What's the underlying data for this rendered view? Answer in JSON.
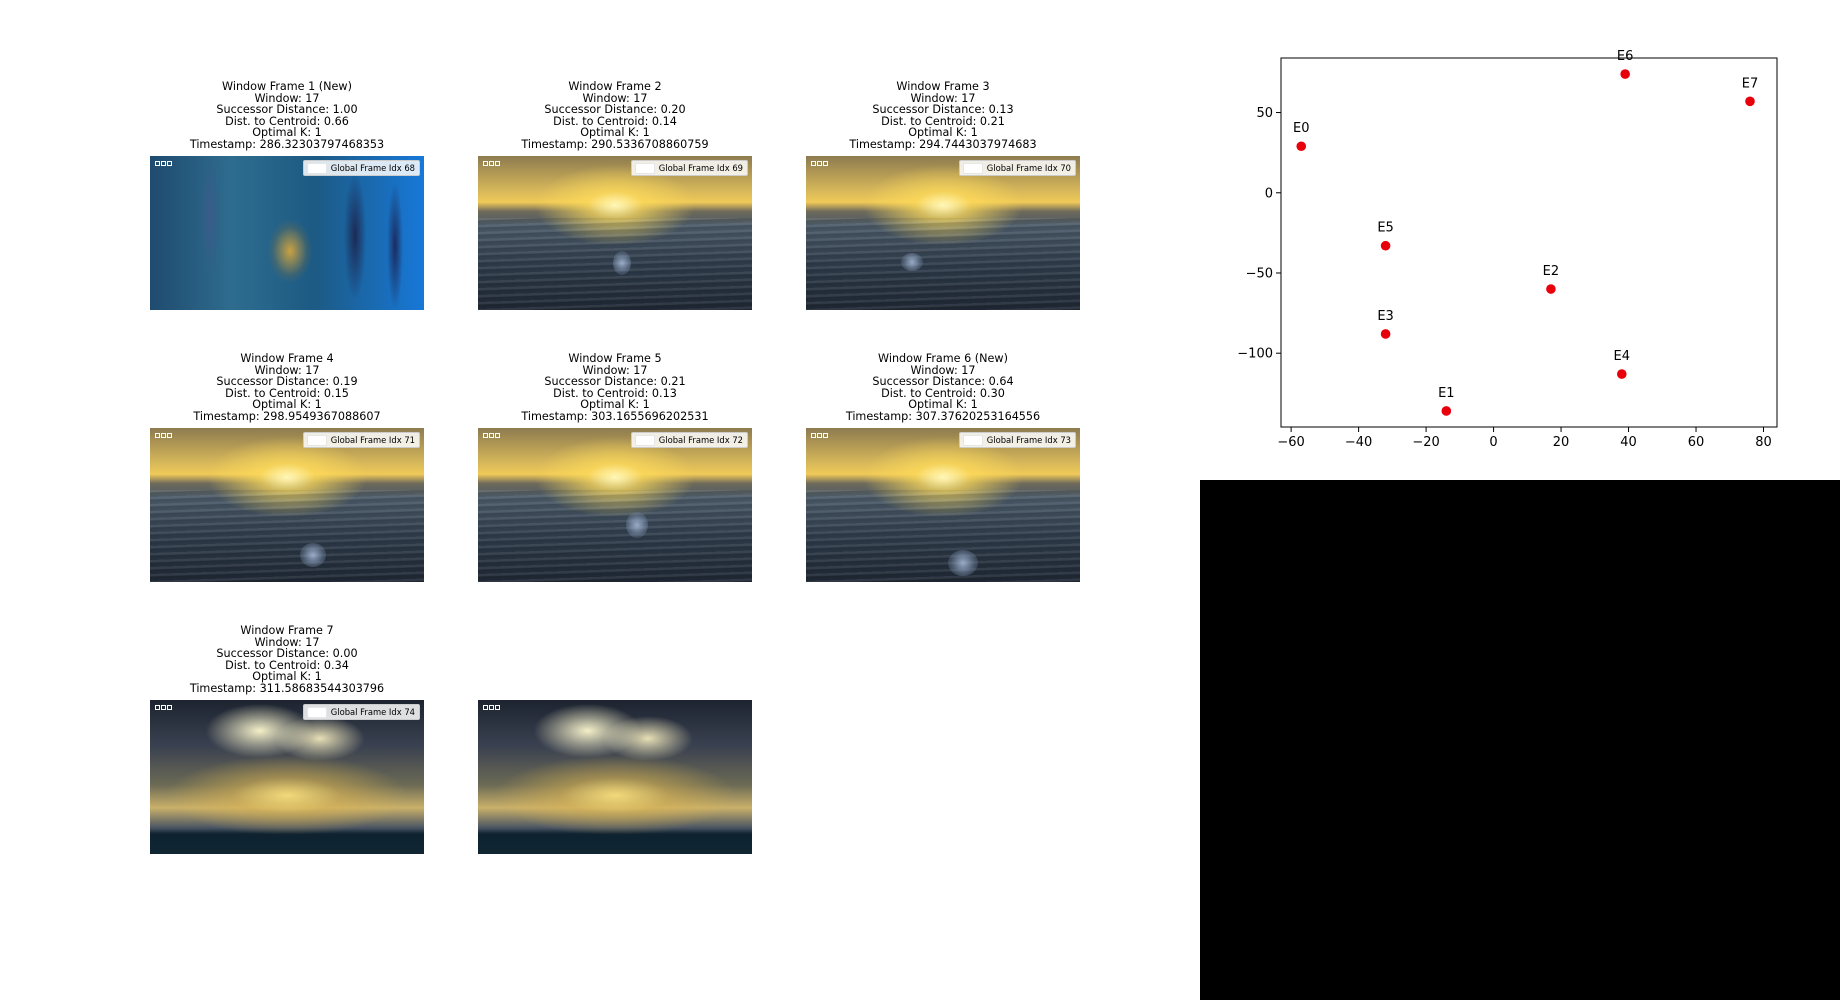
{
  "frames": [
    {
      "id": 1,
      "title": "Window Frame 1 (New)",
      "window": "Window: 17",
      "successor": "Successor Distance: 1.00",
      "centroid": "Dist. to Centroid: 0.66",
      "optimal_k": "Optimal K: 1",
      "timestamp": "Timestamp: 286.32303797468353",
      "legend": "Global Frame Idx 68",
      "scene": "jellyfish-underwater"
    },
    {
      "id": 2,
      "title": "Window Frame 2",
      "window": "Window: 17",
      "successor": "Successor Distance: 0.20",
      "centroid": "Dist. to Centroid: 0.14",
      "optimal_k": "Optimal K: 1",
      "timestamp": "Timestamp: 290.5336708860759",
      "legend": "Global Frame Idx 69",
      "scene": "ocean-sunset"
    },
    {
      "id": 3,
      "title": "Window Frame 3",
      "window": "Window: 17",
      "successor": "Successor Distance: 0.13",
      "centroid": "Dist. to Centroid: 0.21",
      "optimal_k": "Optimal K: 1",
      "timestamp": "Timestamp: 294.7443037974683",
      "legend": "Global Frame Idx 70",
      "scene": "ocean-sunset"
    },
    {
      "id": 4,
      "title": "Window Frame 4",
      "window": "Window: 17",
      "successor": "Successor Distance: 0.19",
      "centroid": "Dist. to Centroid: 0.15",
      "optimal_k": "Optimal K: 1",
      "timestamp": "Timestamp: 298.9549367088607",
      "legend": "Global Frame Idx 71",
      "scene": "ocean-sunset"
    },
    {
      "id": 5,
      "title": "Window Frame 5",
      "window": "Window: 17",
      "successor": "Successor Distance: 0.21",
      "centroid": "Dist. to Centroid: 0.13",
      "optimal_k": "Optimal K: 1",
      "timestamp": "Timestamp: 303.1655696202531",
      "legend": "Global Frame Idx 72",
      "scene": "ocean-sunset"
    },
    {
      "id": 6,
      "title": "Window Frame 6 (New)",
      "window": "Window: 17",
      "successor": "Successor Distance: 0.64",
      "centroid": "Dist. to Centroid: 0.30",
      "optimal_k": "Optimal K: 1",
      "timestamp": "Timestamp: 307.37620253164556",
      "legend": "Global Frame Idx 73",
      "scene": "ocean-sunset"
    },
    {
      "id": 7,
      "title": "Window Frame 7",
      "window": "Window: 17",
      "successor": "Successor Distance: 0.00",
      "centroid": "Dist. to Centroid: 0.34",
      "optimal_k": "Optimal K: 1",
      "timestamp": "Timestamp: 311.58683544303796",
      "legend": "Global Frame Idx 74",
      "scene": "sunrays-clouds"
    }
  ],
  "extra_thumbnail": {
    "scene": "sunrays-clouds"
  },
  "chart_data": {
    "type": "scatter",
    "title": "",
    "xlabel": "",
    "ylabel": "",
    "xlim": [
      -63,
      84
    ],
    "ylim": [
      -146,
      84
    ],
    "xticks": [
      -60,
      -40,
      -20,
      0,
      20,
      40,
      60,
      80
    ],
    "yticks": [
      50,
      0,
      -50,
      -100
    ],
    "grid": false,
    "point_color": "#e8000b",
    "points": [
      {
        "label": "E0",
        "x": -57,
        "y": 29
      },
      {
        "label": "E1",
        "x": -14,
        "y": -136
      },
      {
        "label": "E2",
        "x": 17,
        "y": -60
      },
      {
        "label": "E3",
        "x": -32,
        "y": -88
      },
      {
        "label": "E4",
        "x": 38,
        "y": -113
      },
      {
        "label": "E5",
        "x": -32,
        "y": -33
      },
      {
        "label": "E6",
        "x": 39,
        "y": 74
      },
      {
        "label": "E7",
        "x": 76,
        "y": 57
      }
    ]
  }
}
